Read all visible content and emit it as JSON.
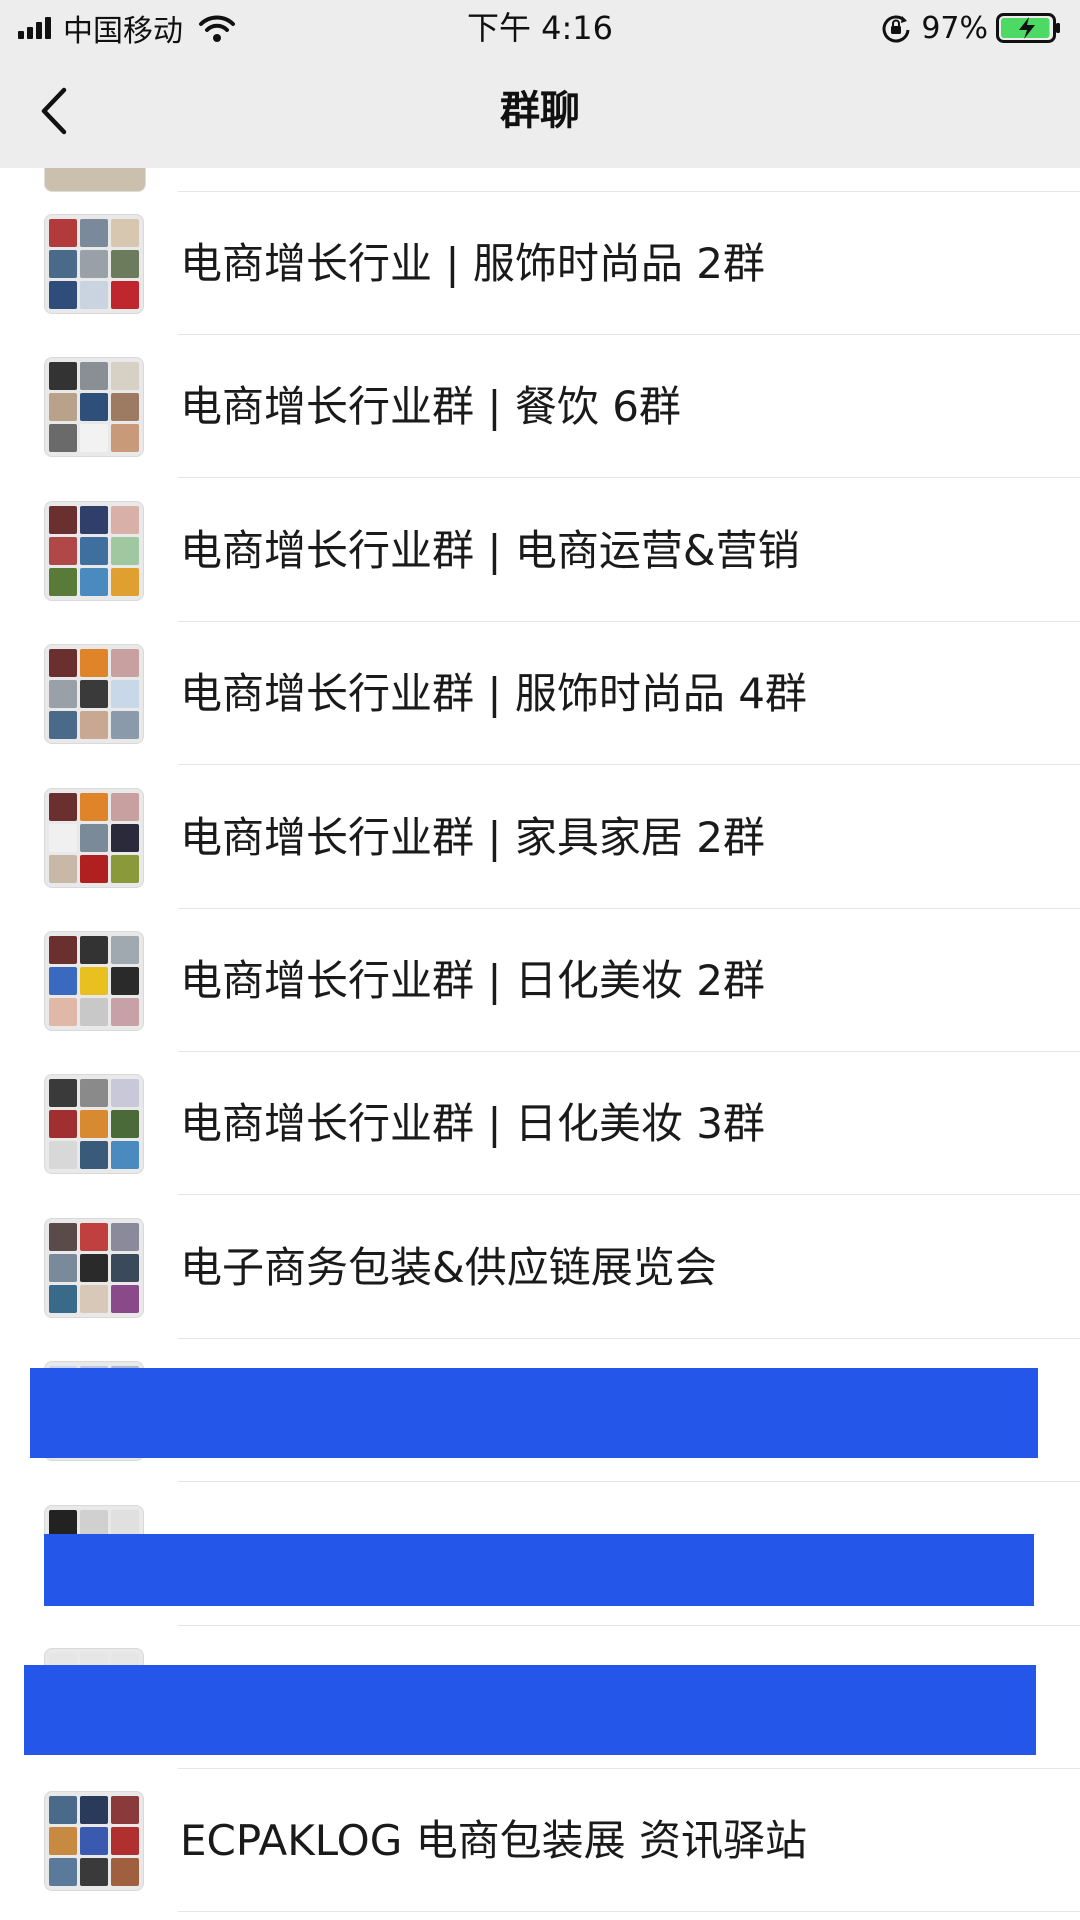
{
  "status_bar": {
    "carrier": "中国移动",
    "time": "下午 4:16",
    "battery_percent": "97%",
    "battery_level": 0.97,
    "icons": [
      "signal-icon",
      "wifi-icon",
      "rotation-lock-icon",
      "battery-charging-icon"
    ]
  },
  "nav": {
    "title": "群聊",
    "back_icon": "chevron-left-icon"
  },
  "groups": [
    {
      "name": "电商增长行业 | 服饰时尚品 2群"
    },
    {
      "name": "电商增长行业群 | 餐饮 6群"
    },
    {
      "name": "电商增长行业群 | 电商运营&营销"
    },
    {
      "name": "电商增长行业群 | 服饰时尚品 4群"
    },
    {
      "name": "电商增长行业群 | 家具家居 2群"
    },
    {
      "name": "电商增长行业群 | 日化美妆 2群"
    },
    {
      "name": "电商增长行业群 | 日化美妆 3群"
    },
    {
      "name": "电子商务包装&供应链展览会"
    },
    {
      "name": ""
    },
    {
      "name": ""
    },
    {
      "name": ""
    },
    {
      "name": "ECPAKLOG 电商包装展 资讯驿站"
    }
  ],
  "colors": {
    "header_bg": "#ededed",
    "redaction": "#2456ea",
    "battery_fill": "#4cd964"
  }
}
